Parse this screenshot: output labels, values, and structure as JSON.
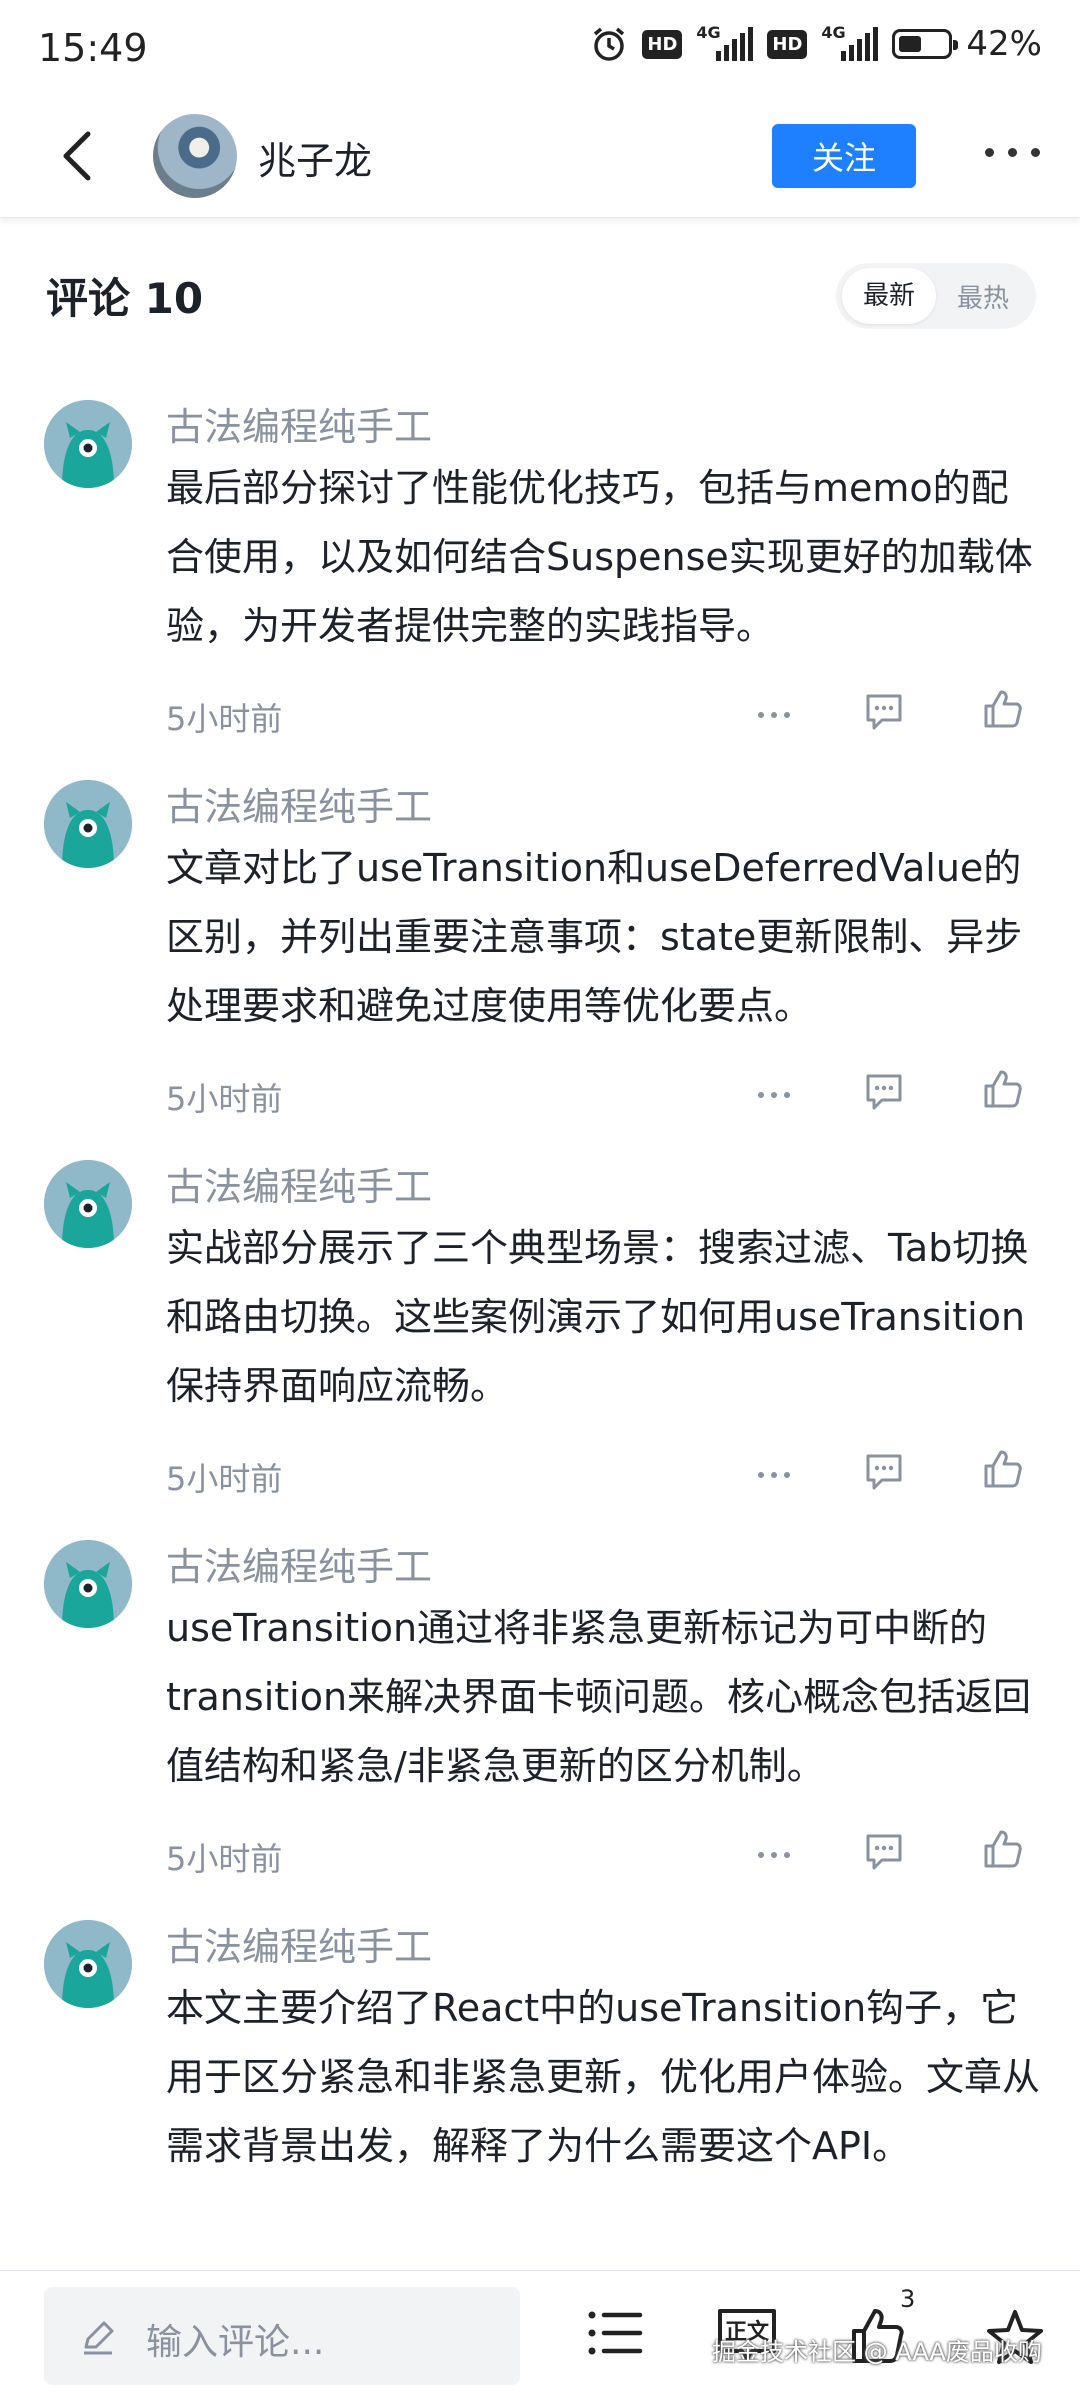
{
  "status_bar": {
    "time": "15:49",
    "hd1": "HD",
    "net1": "4G",
    "hd2": "HD",
    "net2": "4G",
    "battery": "42%"
  },
  "header": {
    "username": "兆子龙",
    "follow_label": "关注"
  },
  "comments_header": {
    "title": "评论 10",
    "sort_newest": "最新",
    "sort_hottest": "最热"
  },
  "comments": [
    {
      "author": "古法编程纯手工",
      "text": "最后部分探讨了性能优化技巧，包括与memo的配合使用，以及如何结合Suspense实现更好的加载体验，为开发者提供完整的实践指导。",
      "time": "5小时前"
    },
    {
      "author": "古法编程纯手工",
      "text": "文章对比了useTransition和useDeferredValue的区别，并列出重要注意事项：state更新限制、异步处理要求和避免过度使用等优化要点。",
      "time": "5小时前"
    },
    {
      "author": "古法编程纯手工",
      "text": "实战部分展示了三个典型场景：搜索过滤、Tab切换和路由切换。这些案例演示了如何用useTransition保持界面响应流畅。",
      "time": "5小时前"
    },
    {
      "author": "古法编程纯手工",
      "text": "useTransition通过将非紧急更新标记为可中断的transition来解决界面卡顿问题。核心概念包括返回值结构和紧急/非紧急更新的区分机制。",
      "time": "5小时前"
    },
    {
      "author": "古法编程纯手工",
      "text": "本文主要介绍了React中的useTransition钩子，它用于区分紧急和非紧急更新，优化用户体验。文章从需求背景出发，解释了为什么需要这个API。",
      "time": ""
    }
  ],
  "bottom_bar": {
    "input_placeholder": "输入评论...",
    "text_icon_label": "正文",
    "like_count": "3"
  },
  "watermark": "掘金技术社区 @ AAA废品收购",
  "colors": {
    "accent": "#1e80ff",
    "secondary_text": "#8a919f",
    "primary_text": "#1d2129",
    "avatar_bg": "#8fb8c9",
    "avatar_fg": "#1aa69a"
  }
}
